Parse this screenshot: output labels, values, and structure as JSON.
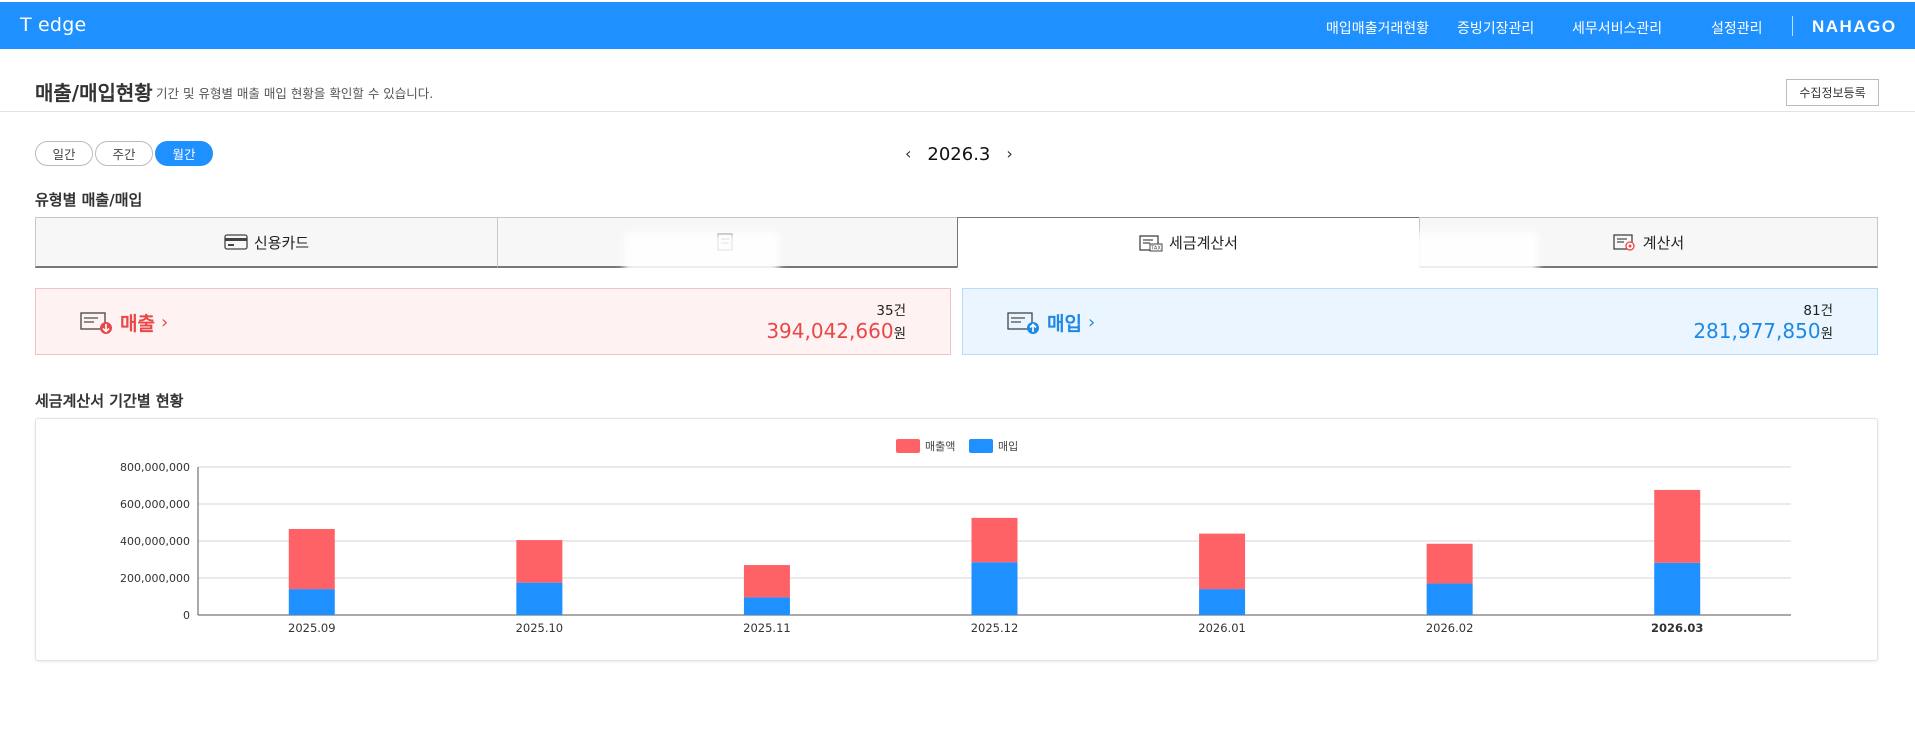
{
  "header": {
    "brand": "T edge",
    "nav": [
      "매입매출거래현황",
      "증빙기장관리",
      "세무서비스관리",
      "설정관리"
    ],
    "logo": "NAHAGO"
  },
  "page": {
    "title": "매출/매입현황",
    "description": "기간 및 유형별 매출 매입 현황을 확인할 수 있습니다.",
    "collect_button": "수집정보등록"
  },
  "period": {
    "options": [
      "일간",
      "주간",
      "월간"
    ],
    "selected": "월간",
    "current": "2026.3"
  },
  "type_section": {
    "title": "유형별 매출/매입",
    "tabs": [
      {
        "label": "신용카드",
        "icon": "credit-card-icon"
      },
      {
        "label": "",
        "icon": "receipt-icon"
      },
      {
        "label": "세금계산서",
        "icon": "tax-invoice-icon"
      },
      {
        "label": "계산서",
        "icon": "invoice-icon"
      }
    ],
    "active_tab": "세금계산서"
  },
  "summary": {
    "sales": {
      "label": "매출",
      "count": "35",
      "count_unit": "건",
      "amount": "394,042,660",
      "amount_unit": "원",
      "color": "#e84848"
    },
    "purchase": {
      "label": "매입",
      "count": "81",
      "count_unit": "건",
      "amount": "281,977,850",
      "amount_unit": "원",
      "color": "#1e88e5"
    }
  },
  "chart_section": {
    "title": "세금계산서 기간별 현황"
  },
  "chart_data": {
    "type": "bar",
    "stacked": true,
    "categories": [
      "2025.09",
      "2025.10",
      "2025.11",
      "2025.12",
      "2026.01",
      "2026.02",
      "2026.03"
    ],
    "highlight_category": "2026.03",
    "series": [
      {
        "name": "매입",
        "color": "#1e90ff",
        "values": [
          140000000,
          175000000,
          95000000,
          285000000,
          140000000,
          170000000,
          282000000
        ]
      },
      {
        "name": "매출액",
        "color": "#ff6266",
        "values": [
          325000000,
          230000000,
          175000000,
          240000000,
          300000000,
          215000000,
          394000000
        ]
      }
    ],
    "legend_order": [
      "매출액",
      "매입"
    ],
    "legend_position": "top-center",
    "yticks": [
      "0",
      "200,000,000",
      "400,000,000",
      "600,000,000",
      "800,000,000"
    ],
    "ylim": [
      0,
      800000000
    ],
    "grid": true
  }
}
